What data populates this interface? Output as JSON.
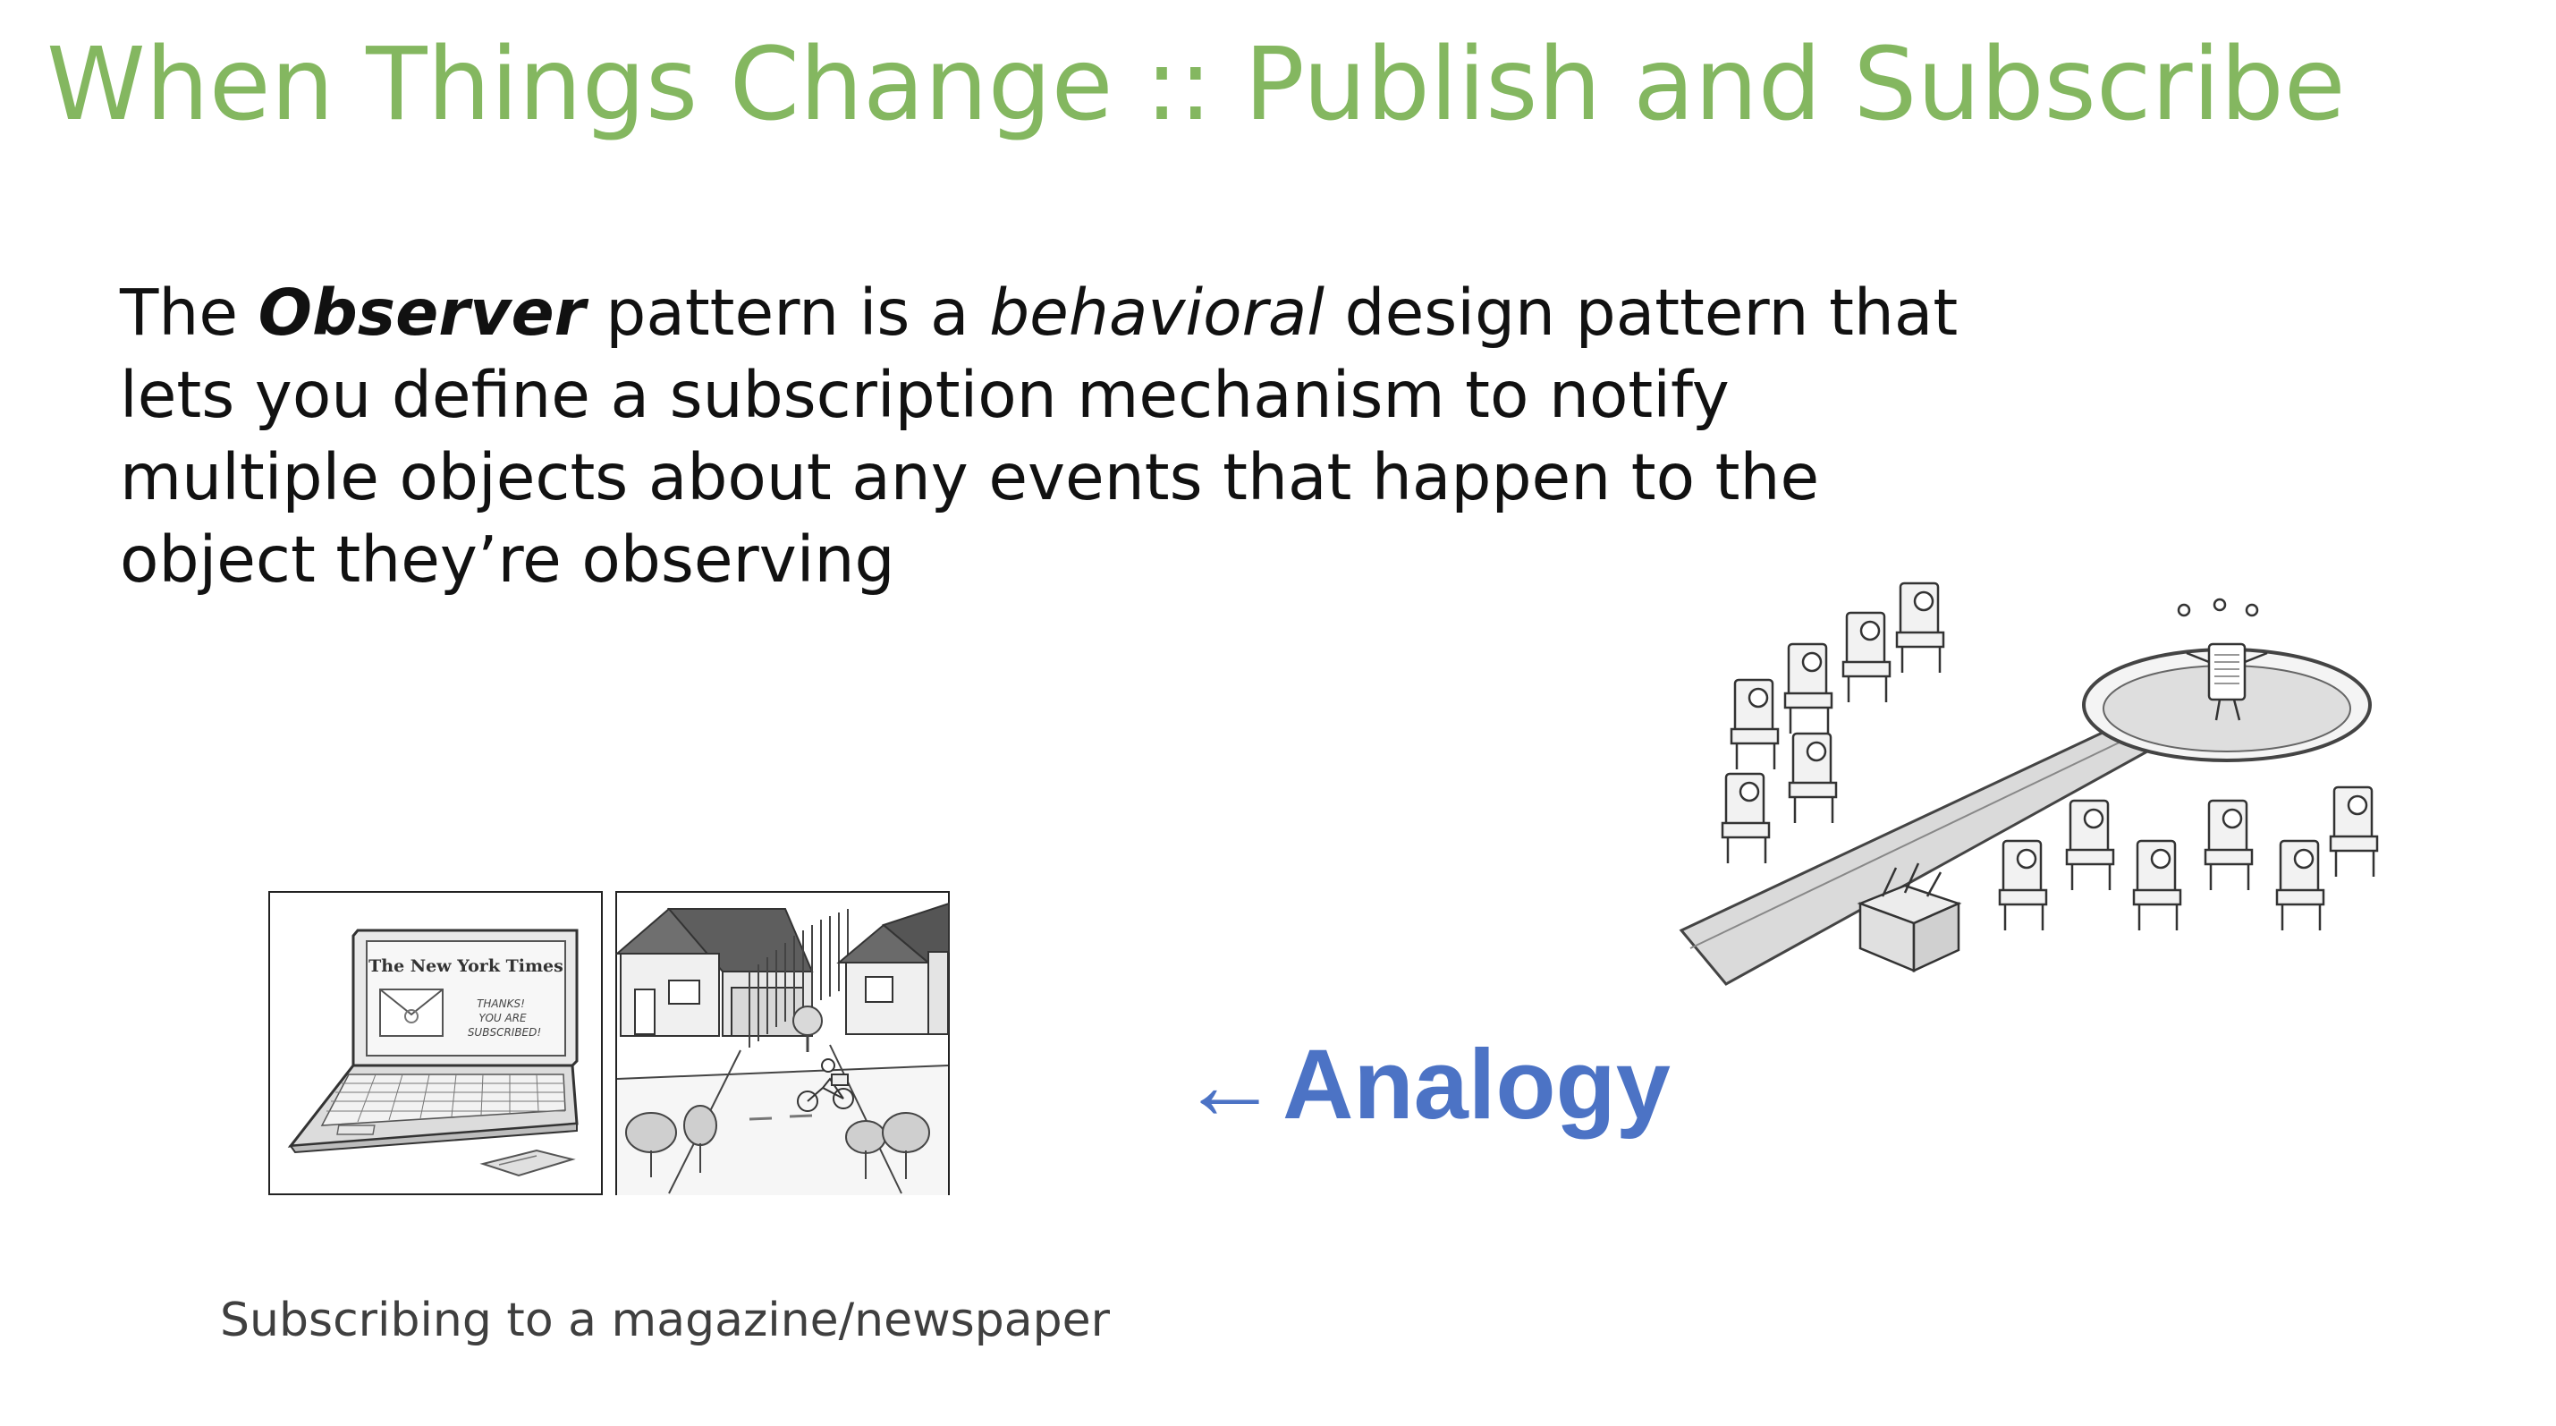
{
  "slide": {
    "title": "When Things Change :: Publish and Subscribe",
    "body": {
      "line1": {
        "pre": "The ",
        "em1": "Observer",
        "mid": " pattern is a ",
        "em2": "behavioral",
        "post": " design pattern that"
      },
      "line2": "lets you define a subscription mechanism to notify",
      "line3": "multiple objects about any events that happen to the",
      "line4": "object they’re observing"
    },
    "laptop_illustration": {
      "masthead": "The New York Times",
      "message": [
        "THANKS!",
        "YOU ARE",
        "SUBSCRIBED!"
      ]
    },
    "analogy": {
      "arrow": "←",
      "label": "Analogy"
    },
    "caption": "Subscribing to a magazine/newspaper",
    "colors": {
      "title": "#84b760",
      "analogy": "#4c73c5",
      "text": "#111111",
      "caption": "#3f3f3f"
    }
  }
}
